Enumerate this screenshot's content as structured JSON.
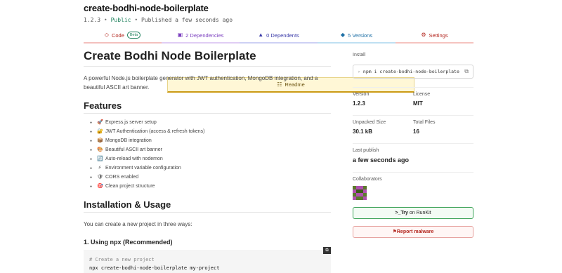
{
  "package": {
    "name": "create-bodhi-node-boilerplate",
    "version": "1.2.3",
    "visibility": "Public",
    "published": "Published a few seconds ago",
    "separator": "•"
  },
  "tabs": [
    {
      "label": "Readme",
      "icon": "readme-icon"
    },
    {
      "label": "Code",
      "badge": "Beta",
      "icon": "code-icon"
    },
    {
      "label": "2 Dependencies",
      "icon": "dependencies-icon"
    },
    {
      "label": "0 Dependents",
      "icon": "dependents-icon"
    },
    {
      "label": "5 Versions",
      "icon": "versions-icon"
    },
    {
      "label": "Settings",
      "icon": "settings-icon"
    }
  ],
  "readme": {
    "title": "Create Bodhi Node Boilerplate",
    "description": "A powerful Node.js boilerplate generator with JWT authentication, MongoDB integration, and a beautiful ASCII art banner.",
    "features_heading": "Features",
    "features": [
      {
        "emoji": "🚀",
        "text": "Express.js server setup"
      },
      {
        "emoji": "🔐",
        "text": "JWT Authentication (access & refresh tokens)"
      },
      {
        "emoji": "📦",
        "text": "MongoDB integration"
      },
      {
        "emoji": "🎨",
        "text": "Beautiful ASCII art banner"
      },
      {
        "emoji": "🔄",
        "text": "Auto-reload with nodemon"
      },
      {
        "emoji": "⚡",
        "text": "Environment variable configuration"
      },
      {
        "emoji": "🛡",
        "text": "CORS enabled"
      },
      {
        "emoji": "🎯",
        "text": "Clean project structure"
      }
    ],
    "install_heading": "Installation & Usage",
    "install_intro": "You can create a new project in three ways:",
    "npx_heading": "1. Using npx (Recommended)",
    "code_comment": "# Create a new project",
    "code_command": "npx create-bodhi-node-boilerplate my-project"
  },
  "sidebar": {
    "install_label": "Install",
    "install_command": "npm i create-bodhi-node-boilerplate",
    "version_label": "Version",
    "version_value": "1.2.3",
    "license_label": "License",
    "license_value": "MIT",
    "unpacked_label": "Unpacked Size",
    "unpacked_value": "30.1 kB",
    "total_files_label": "Total Files",
    "total_files_value": "16",
    "last_publish_label": "Last publish",
    "last_publish_value": "a few seconds ago",
    "collaborators_label": "Collaborators",
    "runkit_label": ">_Try",
    "runkit_suffix": "on RunKit",
    "report_label": "Report malware"
  }
}
